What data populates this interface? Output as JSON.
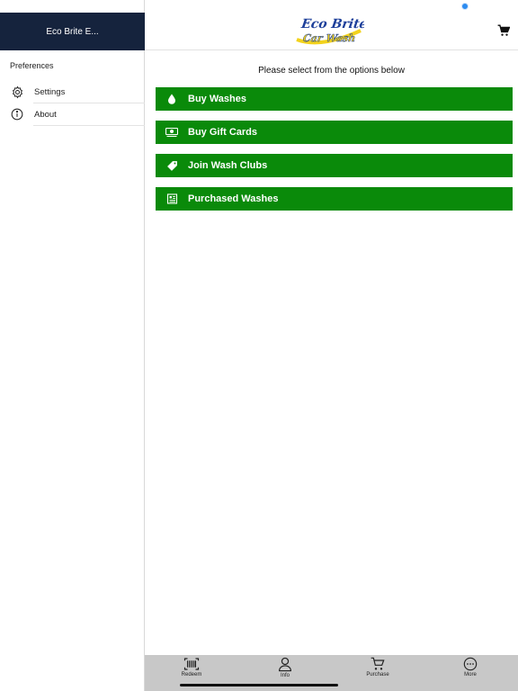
{
  "sidebar": {
    "title": "Eco Brite E...",
    "section_label": "Preferences",
    "items": [
      {
        "label": "Settings",
        "icon": "gear-icon"
      },
      {
        "label": "About",
        "icon": "info-circle-icon"
      }
    ]
  },
  "header": {
    "logo_text_line1": "Eco Brite",
    "logo_text_line2": "Car Wash",
    "cart_icon": "cart-icon"
  },
  "main": {
    "prompt": "Please select from the options below",
    "options": [
      {
        "label": "Buy Washes",
        "icon": "droplet-icon"
      },
      {
        "label": "Buy Gift Cards",
        "icon": "cash-icon"
      },
      {
        "label": "Join Wash Clubs",
        "icon": "tag-icon"
      },
      {
        "label": "Purchased Washes",
        "icon": "receipt-icon"
      }
    ]
  },
  "tabbar": {
    "tabs": [
      {
        "label": "Redeem",
        "icon": "barcode-icon"
      },
      {
        "label": "Info",
        "icon": "person-icon"
      },
      {
        "label": "Purchase",
        "icon": "cart-icon"
      },
      {
        "label": "More",
        "icon": "ellipsis-circle-icon"
      }
    ]
  },
  "colors": {
    "sidebar_header": "#15233d",
    "option_green": "#0a8a0a",
    "tabbar_bg": "#c8c8c8",
    "logo_blue": "#1d3f9a",
    "logo_yellow": "#f2d21c"
  }
}
